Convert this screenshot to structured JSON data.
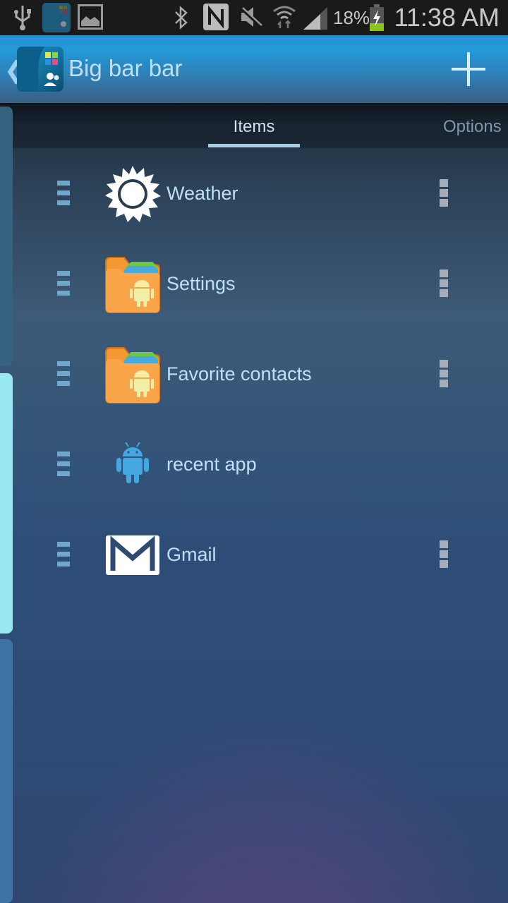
{
  "status_bar": {
    "left_icons": [
      "usb-icon",
      "app-notification-icon",
      "image-icon"
    ],
    "right_icons": [
      "bluetooth-icon",
      "nfc-icon",
      "mute-icon",
      "wifi-icon",
      "signal-icon",
      "battery-charging-icon"
    ],
    "battery_percent": "18%",
    "time": "11:38 AM",
    "battery_color": "#8bc516"
  },
  "action_bar": {
    "back_glyph": "❮",
    "title": "Big bar bar",
    "add_icon": "plus-icon"
  },
  "tabs": [
    {
      "label": "Items",
      "selected": true
    },
    {
      "label": "Options",
      "selected": false
    }
  ],
  "side_handles": [
    {
      "name": "left-bar-handle-top",
      "active": false
    },
    {
      "name": "left-bar-handle-middle",
      "active": true
    },
    {
      "name": "left-bar-handle-bottom",
      "active": false
    }
  ],
  "items": [
    {
      "label": "Weather",
      "icon": "sun-icon",
      "has_menu": true
    },
    {
      "label": "Settings",
      "icon": "android-folder-icon",
      "has_menu": true
    },
    {
      "label": "Favorite contacts",
      "icon": "android-folder-icon",
      "has_menu": true
    },
    {
      "label": "recent app",
      "icon": "android-robot-icon",
      "has_menu": false
    },
    {
      "label": "Gmail",
      "icon": "gmail-icon",
      "has_menu": true
    }
  ],
  "colors": {
    "accent": "#239ad9",
    "tab_indicator": "#a9cfe6",
    "active_handle": "#97e8f0",
    "text": "#bfe0f4"
  }
}
